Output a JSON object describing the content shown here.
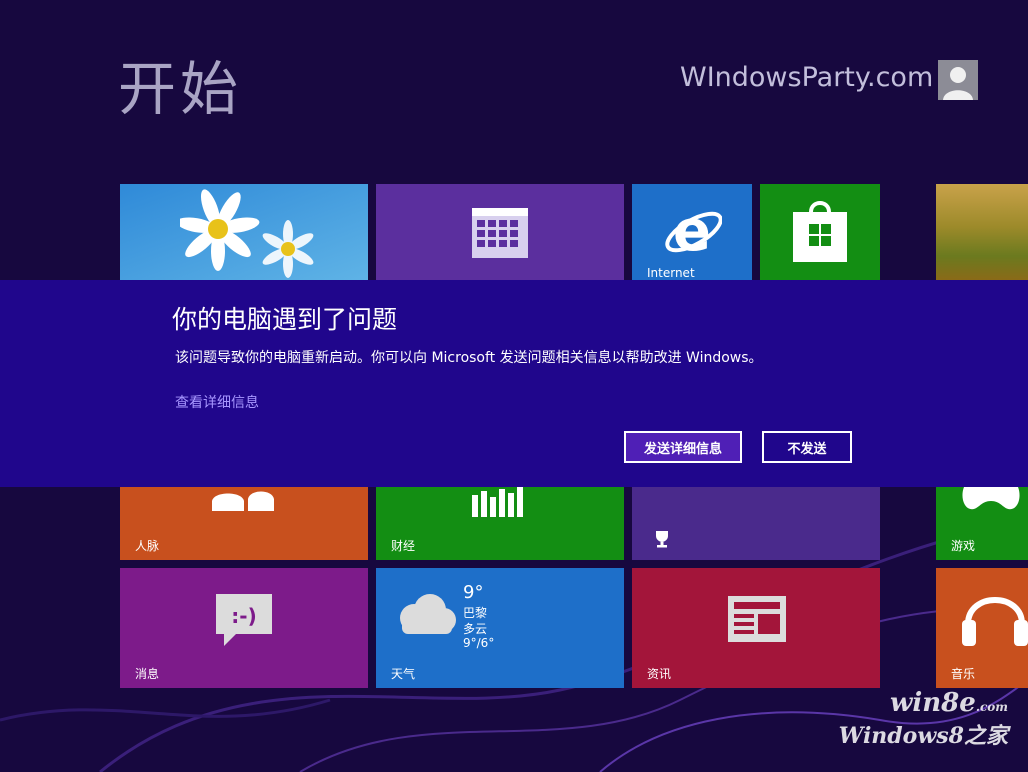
{
  "start": {
    "title": "开始",
    "user_name": "WIndowsParty.com"
  },
  "tiles": {
    "photos": "",
    "calendar": "",
    "internet": "Internet",
    "store": "",
    "people": "人脉",
    "finance": "财经",
    "games": "游戏",
    "messaging": "消息",
    "weather": "天气",
    "news": "资讯",
    "music": "音乐"
  },
  "weather": {
    "temp": "9°",
    "city": "巴黎",
    "condition": "多云",
    "range": "9°/6°"
  },
  "dialog": {
    "title": "你的电脑遇到了问题",
    "message": "该问题导致你的电脑重新启动。你可以向 Microsoft 发送问题相关信息以帮助改进 Windows。",
    "details_link": "查看详细信息",
    "send_button": "发送详细信息",
    "dont_send_button": "不发送"
  },
  "watermark": {
    "line1": "win8e",
    "line1_suffix": ".com",
    "line2": "Windows8之家"
  },
  "colors": {
    "background": "#17083f",
    "dialog": "#20068c",
    "link": "#a796ff",
    "tile_blue": "#1e6fc9",
    "tile_purple": "#5b2f9e",
    "tile_green": "#138e13",
    "tile_orange": "#c8501e",
    "tile_magenta": "#7d1b8a",
    "tile_red": "#a3153a"
  }
}
